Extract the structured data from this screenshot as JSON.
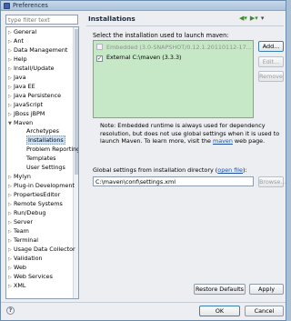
{
  "window": {
    "title": "Preferences"
  },
  "filter": {
    "placeholder": "type filter text"
  },
  "tree": [
    {
      "label": "General",
      "level": 0,
      "expandable": true
    },
    {
      "label": "Ant",
      "level": 0,
      "expandable": true
    },
    {
      "label": "Data Management",
      "level": 0,
      "expandable": true
    },
    {
      "label": "Help",
      "level": 0,
      "expandable": true
    },
    {
      "label": "Install/Update",
      "level": 0,
      "expandable": true
    },
    {
      "label": "Java",
      "level": 0,
      "expandable": true
    },
    {
      "label": "Java EE",
      "level": 0,
      "expandable": true
    },
    {
      "label": "Java Persistence",
      "level": 0,
      "expandable": true
    },
    {
      "label": "JavaScript",
      "level": 0,
      "expandable": true
    },
    {
      "label": "JBoss jBPM",
      "level": 0,
      "expandable": true
    },
    {
      "label": "Maven",
      "level": 0,
      "expandable": true,
      "expanded": true
    },
    {
      "label": "Archetypes",
      "level": 1
    },
    {
      "label": "Installations",
      "level": 1,
      "selected": true
    },
    {
      "label": "Problem Reporting",
      "level": 1
    },
    {
      "label": "Templates",
      "level": 1
    },
    {
      "label": "User Settings",
      "level": 1
    },
    {
      "label": "Mylyn",
      "level": 0,
      "expandable": true
    },
    {
      "label": "Plug-in Development",
      "level": 0,
      "expandable": true
    },
    {
      "label": "PropertiesEditor",
      "level": 0,
      "expandable": true
    },
    {
      "label": "Remote Systems",
      "level": 0,
      "expandable": true
    },
    {
      "label": "Run/Debug",
      "level": 0,
      "expandable": true
    },
    {
      "label": "Server",
      "level": 0,
      "expandable": true
    },
    {
      "label": "Team",
      "level": 0,
      "expandable": true
    },
    {
      "label": "Terminal",
      "level": 0,
      "expandable": true
    },
    {
      "label": "Usage Data Collector",
      "level": 0,
      "expandable": true
    },
    {
      "label": "Validation",
      "level": 0,
      "expandable": true
    },
    {
      "label": "Web",
      "level": 0,
      "expandable": true
    },
    {
      "label": "Web Services",
      "level": 0,
      "expandable": true
    },
    {
      "label": "XML",
      "level": 0,
      "expandable": true
    }
  ],
  "page": {
    "title": "Installations",
    "select_label": "Select the installation used to launch maven:",
    "installations": [
      {
        "label": "Embedded (3.0-SNAPSHOT/0.12.1.20110112-17...",
        "checked": false,
        "disabled": true
      },
      {
        "label": "External C:\\maven (3.3.3)",
        "checked": true,
        "disabled": false
      }
    ],
    "buttons": {
      "add": "Add...",
      "edit": "Edit...",
      "remove": "Remove"
    },
    "note_prefix": "Note: Embedded runtime is always used for dependency resolution, but does not use global settings when it is used to launch Maven. To learn more, visit the ",
    "note_link": "maven",
    "note_suffix": " web page.",
    "global_label": "Global settings from installation directory (",
    "global_link": "open file",
    "global_label_end": "):",
    "global_value": "C:\\maven\\conf\\settings.xml",
    "browse": "Browse...",
    "restore_defaults": "Restore Defaults",
    "apply": "Apply"
  },
  "footer": {
    "help_glyph": "?",
    "ok": "OK",
    "cancel": "Cancel"
  },
  "icons": {
    "nav_back": "back-arrow-icon",
    "nav_forward": "forward-arrow-icon",
    "menu": "view-menu-icon"
  }
}
